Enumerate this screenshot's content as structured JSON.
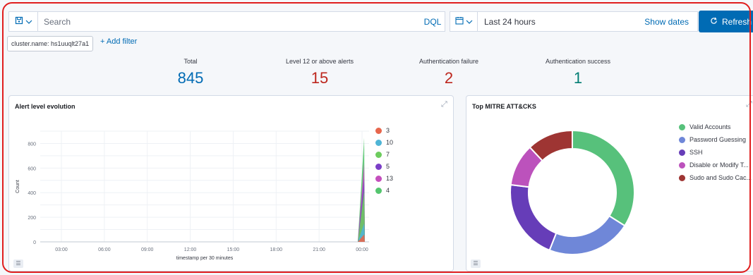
{
  "query": {
    "placeholder": "Search",
    "language": "DQL"
  },
  "time": {
    "range": "Last 24 hours",
    "show_dates": "Show dates",
    "refresh": "Refresh"
  },
  "filters": {
    "pill": "cluster.name: hs1uuqlt27a1",
    "add": "+ Add filter"
  },
  "metrics": [
    {
      "label": "Total",
      "value": "845",
      "color": "#006bb4"
    },
    {
      "label": "Level 12 or above alerts",
      "value": "15",
      "color": "#bd271e"
    },
    {
      "label": "Authentication failure",
      "value": "2",
      "color": "#bd271e"
    },
    {
      "label": "Authentication success",
      "value": "1",
      "color": "#017d73"
    }
  ],
  "panels": {
    "left_title": "Alert level evolution",
    "right_title": "Top MITRE ATT&CKS"
  },
  "chart_data": [
    {
      "type": "area",
      "title": "Alert level evolution",
      "xlabel": "timestamp per 30 minutes",
      "ylabel": "Count",
      "x_ticks": [
        "03:00",
        "06:00",
        "09:00",
        "12:00",
        "15:00",
        "18:00",
        "21:00",
        "00:00"
      ],
      "y_ticks": [
        "0",
        "200",
        "400",
        "600",
        "800"
      ],
      "ylim": [
        0,
        900
      ],
      "legend_position": "right",
      "series": [
        {
          "name": "3",
          "color": "#d36086"
        },
        {
          "name": "10",
          "color": "#54b399"
        },
        {
          "name": "7",
          "color": "#6092c0"
        },
        {
          "name": "5",
          "color": "#9170b8"
        },
        {
          "name": "13",
          "color": "#ca8eae"
        },
        {
          "name": "4",
          "color": "#54b399"
        }
      ],
      "series_colors_display": [
        "#e7664c",
        "#4fb5d6",
        "#6dcc5e",
        "#7b3fc7",
        "#c44fbd",
        "#54c56e"
      ],
      "peak_total": 845
    },
    {
      "type": "pie",
      "title": "Top MITRE ATT&CKS",
      "legend_position": "right",
      "slices": [
        {
          "label": "Valid Accounts",
          "value": 34,
          "color": "#57c17b"
        },
        {
          "label": "Password Guessing",
          "value": 22,
          "color": "#6f87d8"
        },
        {
          "label": "SSH",
          "value": 21,
          "color": "#663db8"
        },
        {
          "label": "Disable or Modify T...",
          "value": 11,
          "color": "#bc52bc"
        },
        {
          "label": "Sudo and Sudo Cac...",
          "value": 12,
          "color": "#9e3533"
        }
      ]
    }
  ]
}
